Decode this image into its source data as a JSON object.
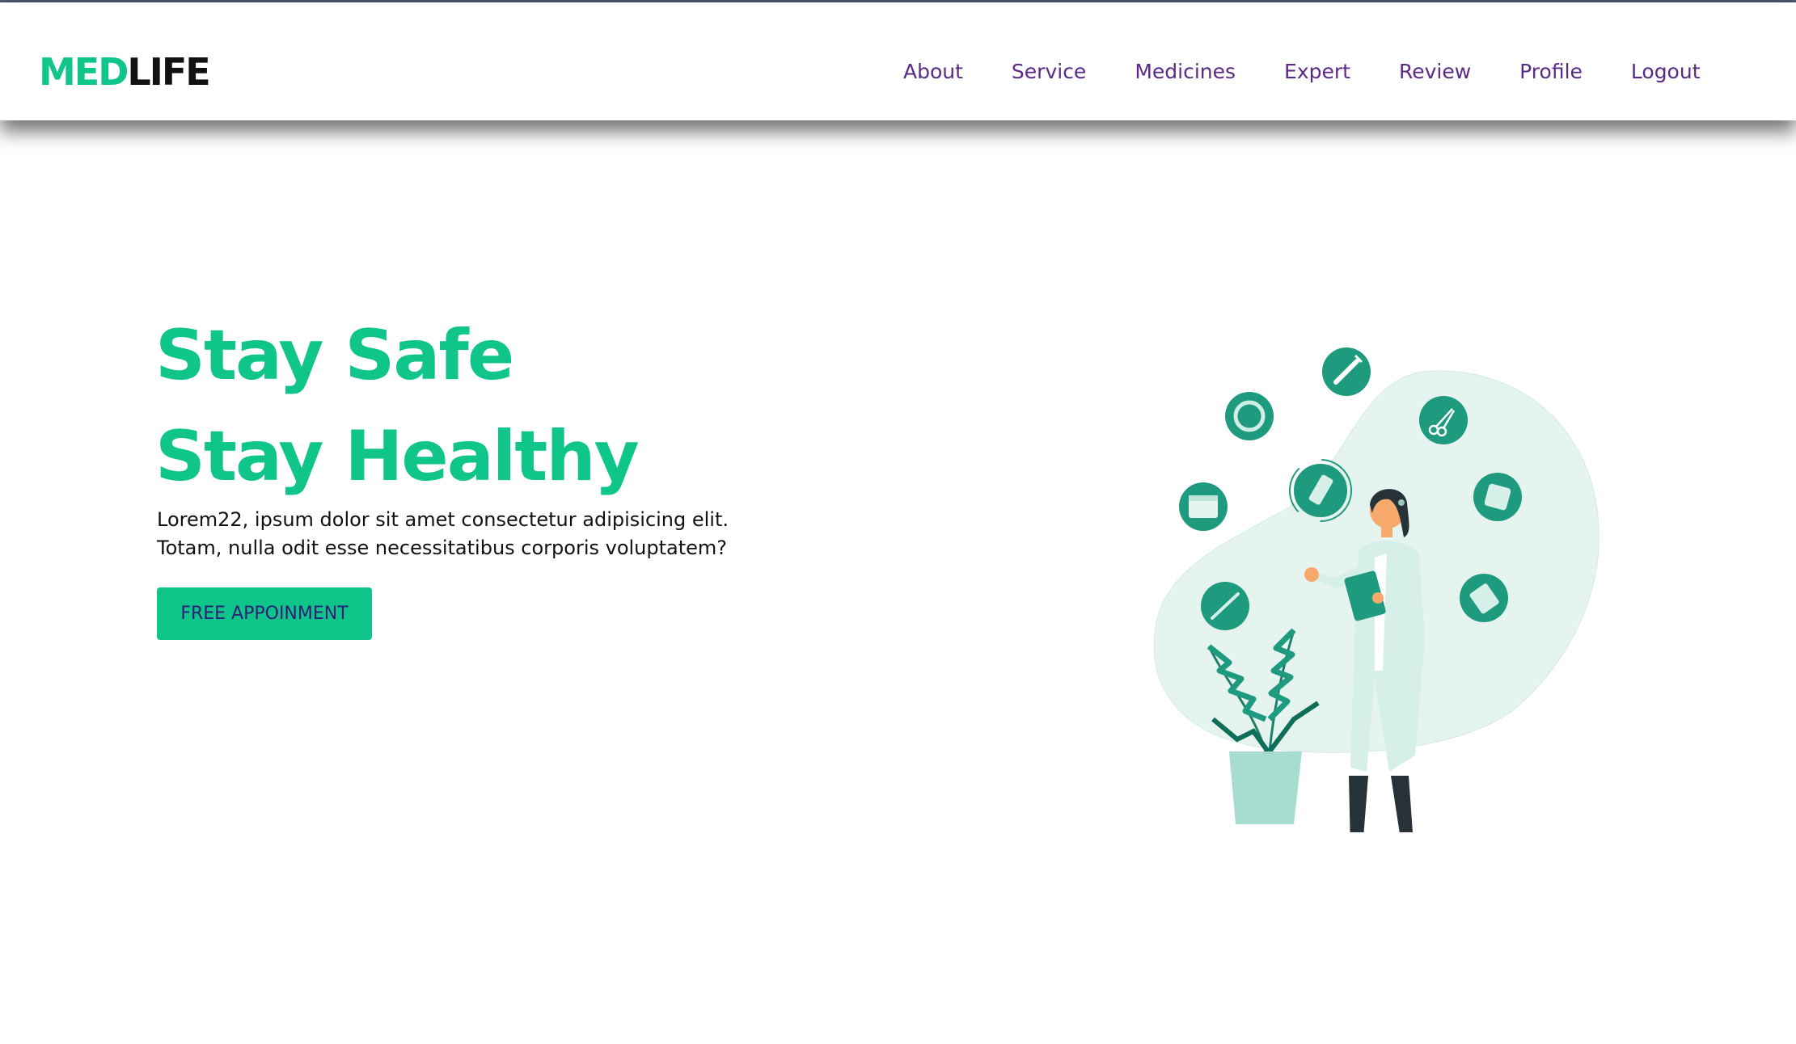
{
  "brand": {
    "part1": "MED",
    "part2": "LIFE"
  },
  "nav": {
    "items": [
      {
        "label": "About"
      },
      {
        "label": "Service"
      },
      {
        "label": "Medicines"
      },
      {
        "label": "Expert"
      },
      {
        "label": "Review"
      },
      {
        "label": "Profile"
      },
      {
        "label": "Logout"
      }
    ]
  },
  "hero": {
    "title_line1": "Stay Safe",
    "title_line2": "Stay Healthy",
    "description": "Lorem22, ipsum dolor sit amet consectetur adipisicing elit. Totam, nulla odit esse necessitatibus corporis voluptatem?",
    "cta_label": "FREE APPOINMENT"
  },
  "colors": {
    "accent": "#0fc58a",
    "nav_text": "#5b2a86",
    "button_text": "#2a1f78",
    "illustration_teal": "#1e9a7e"
  },
  "illustration": {
    "icons": [
      "syringe-icon",
      "scissors-icon",
      "pill-bottle-icon",
      "bandage-icon",
      "pill-pack-icon",
      "calendar-icon",
      "thermometer-icon",
      "pill-icon",
      "medicine-pack-icon"
    ]
  }
}
